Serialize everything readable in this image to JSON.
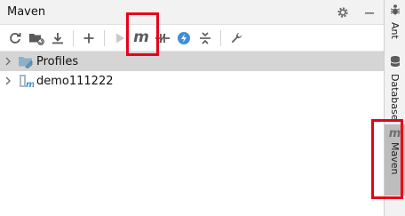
{
  "window": {
    "title": "Maven"
  },
  "title_actions": {
    "settings_icon": "gear-icon",
    "minimize_icon": "minimize-icon"
  },
  "toolbar": {
    "buttons": [
      {
        "name": "reload-button",
        "icon": "reload-icon"
      },
      {
        "name": "generate-sources-button",
        "icon": "folder-generate-icon"
      },
      {
        "name": "download-button",
        "icon": "download-icon"
      },
      {
        "name": "add-button",
        "icon": "plus-icon"
      },
      {
        "name": "run-button",
        "icon": "run-icon"
      },
      {
        "name": "execute-goal-button",
        "icon": "maven-m-icon",
        "glyph": "m"
      },
      {
        "name": "toggle-offline-button",
        "icon": "offline-icon"
      },
      {
        "name": "skip-tests-button",
        "icon": "skip-tests-icon"
      },
      {
        "name": "collapse-all-button",
        "icon": "collapse-icon"
      },
      {
        "name": "settings-button",
        "icon": "wrench-icon"
      }
    ]
  },
  "tree": {
    "items": [
      {
        "label": "Profiles",
        "icon": "profiles-folder-icon",
        "selected": true
      },
      {
        "label": "demo111222",
        "icon": "maven-module-icon",
        "selected": false
      }
    ]
  },
  "sidebar": {
    "tabs": [
      {
        "label": "Ant",
        "icon": "ant-icon"
      },
      {
        "label": "Database",
        "icon": "database-icon"
      },
      {
        "label": "Maven",
        "icon": "maven-icon",
        "glyph": "m",
        "active": true
      }
    ]
  },
  "colors": {
    "highlight": "#e8001a",
    "accent_blue": "#3d8fd6",
    "selection": "#d5d5d5"
  }
}
